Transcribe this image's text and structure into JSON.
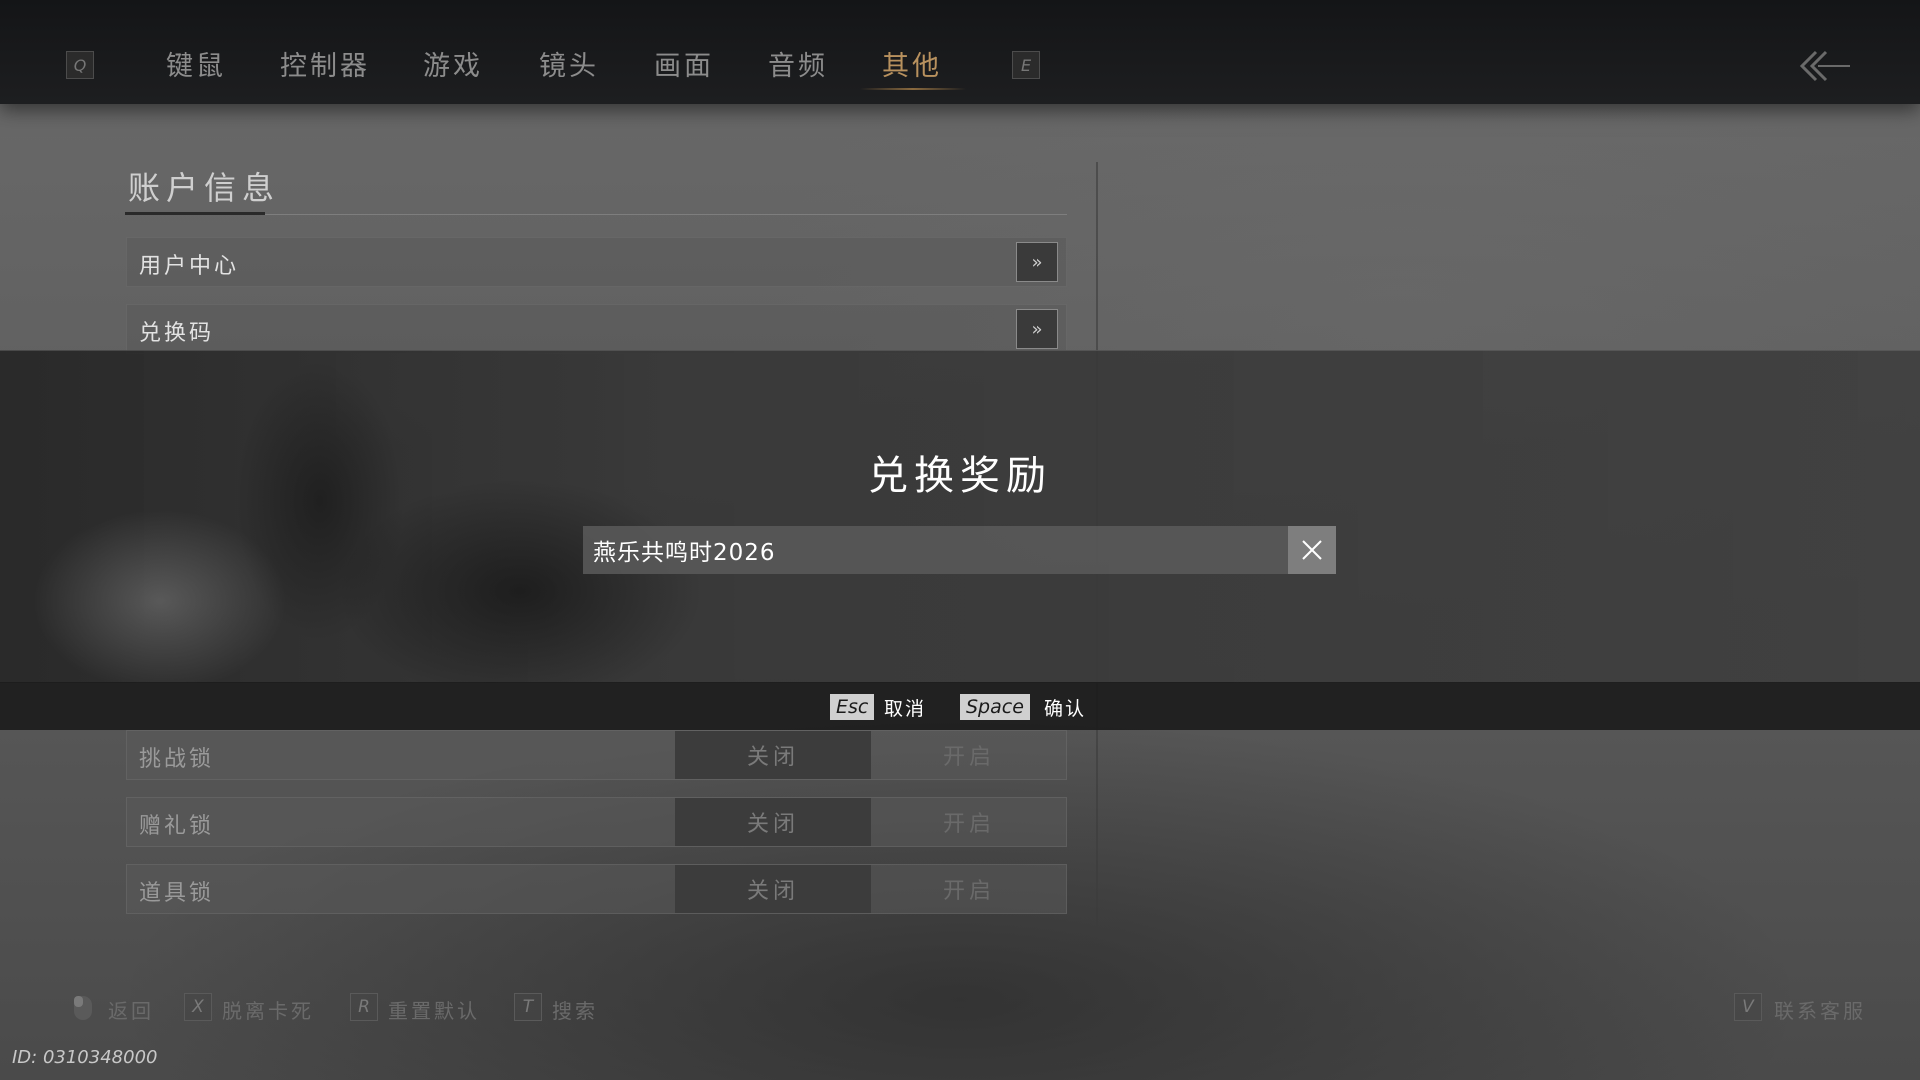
{
  "tabs": {
    "left_key": "Q",
    "right_key": "E",
    "items": [
      "键鼠",
      "控制器",
      "游戏",
      "镜头",
      "画面",
      "音频",
      "其他"
    ],
    "active": "其他"
  },
  "account_section": {
    "title": "账户信息",
    "rows": [
      {
        "label": "用户中心",
        "action": "»"
      },
      {
        "label": "兑换码",
        "action": "»"
      }
    ]
  },
  "locks": [
    {
      "label": "挑战锁",
      "off": "关闭",
      "on": "开启"
    },
    {
      "label": "赠礼锁",
      "off": "关闭",
      "on": "开启"
    },
    {
      "label": "道具锁",
      "off": "关闭",
      "on": "开启"
    }
  ],
  "modal": {
    "title": "兑换奖励",
    "input_value": "燕乐共鸣时2026",
    "cancel_key": "Esc",
    "cancel_label": "取消",
    "confirm_key": "Space",
    "confirm_label": "确认"
  },
  "bottom_hints": {
    "back_label": "返回",
    "unstuck_key": "X",
    "unstuck_label": "脱离卡死",
    "reset_key": "R",
    "reset_label": "重置默认",
    "search_key": "T",
    "search_label": "搜索",
    "support_key": "V",
    "support_label": "联系客服"
  },
  "user_id": "ID: 0310348000",
  "colors": {
    "active_tab": "#b8915e",
    "modal_bg": "#3a3a3a",
    "key_chip": "#d0d0d0"
  }
}
